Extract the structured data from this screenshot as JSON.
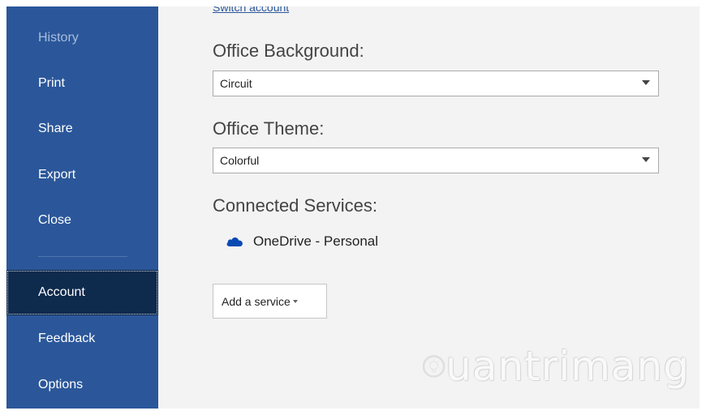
{
  "sidebar": {
    "items": [
      {
        "label": "History"
      },
      {
        "label": "Print"
      },
      {
        "label": "Share"
      },
      {
        "label": "Export"
      },
      {
        "label": "Close"
      },
      {
        "label": "Account"
      },
      {
        "label": "Feedback"
      },
      {
        "label": "Options"
      }
    ],
    "active": "Account"
  },
  "account": {
    "switch_account_link": "Switch account",
    "office_background": {
      "heading": "Office Background:",
      "selected": "Circuit"
    },
    "office_theme": {
      "heading": "Office Theme:",
      "selected": "Colorful"
    },
    "connected_services": {
      "heading": "Connected Services:",
      "services": [
        {
          "name": "OneDrive - Personal",
          "icon": "cloud-icon"
        }
      ],
      "add_service_label": "Add a service"
    }
  },
  "watermark": {
    "text": "uantrimang"
  },
  "colors": {
    "sidebar_bg": "#2b579a",
    "sidebar_active_bg": "#0e2a4d",
    "main_bg": "#f3f3f3",
    "link": "#2b579a",
    "onedrive_blue": "#094ab2"
  }
}
